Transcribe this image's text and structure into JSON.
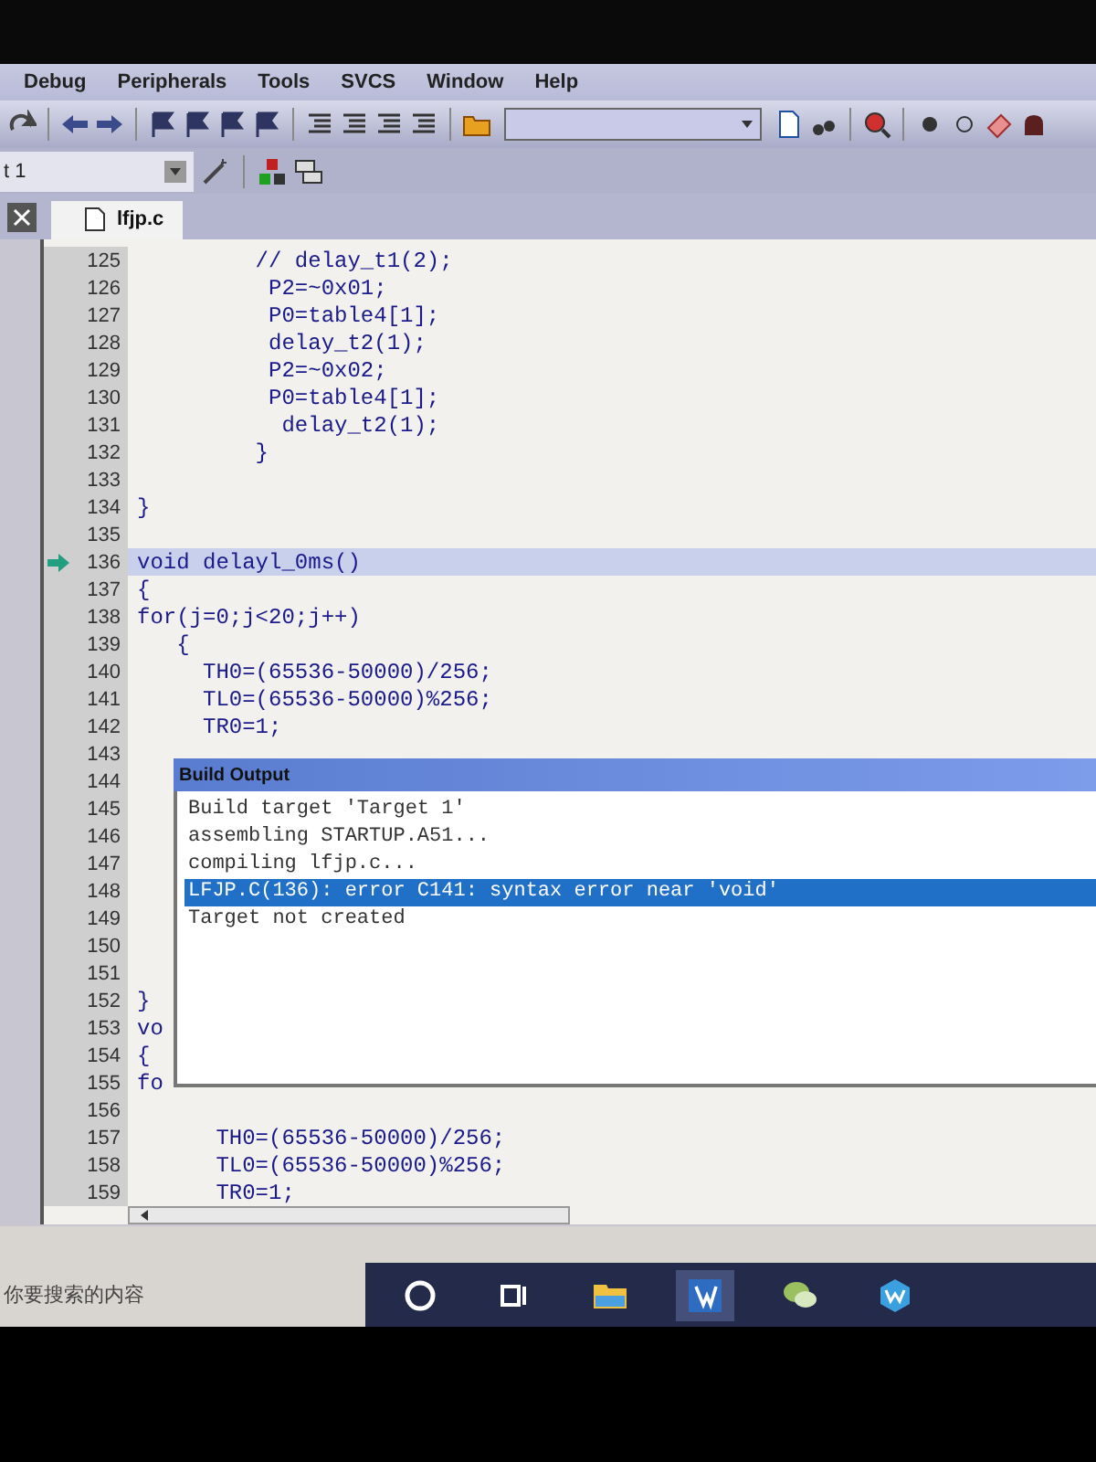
{
  "menu": [
    {
      "label": "Debug"
    },
    {
      "label": "Peripherals"
    },
    {
      "label": "Tools"
    },
    {
      "label": "SVCS"
    },
    {
      "label": "Window"
    },
    {
      "label": "Help"
    }
  ],
  "target_field": {
    "value": "t 1"
  },
  "tabs": [
    {
      "label": "lfjp.c",
      "selected": true
    }
  ],
  "code_lines": [
    {
      "number": "125",
      "text": "         // delay_t1(2);",
      "current": false
    },
    {
      "number": "126",
      "text": "          P2=~0x01;",
      "current": false
    },
    {
      "number": "127",
      "text": "          P0=table4[1];",
      "current": false
    },
    {
      "number": "128",
      "text": "          delay_t2(1);",
      "current": false
    },
    {
      "number": "129",
      "text": "          P2=~0x02;",
      "current": false
    },
    {
      "number": "130",
      "text": "          P0=table4[1];",
      "current": false
    },
    {
      "number": "131",
      "text": "           delay_t2(1);",
      "current": false
    },
    {
      "number": "132",
      "text": "         }",
      "current": false
    },
    {
      "number": "133",
      "current": false
    },
    {
      "number": "134",
      "text": "}",
      "current": false
    },
    {
      "number": "135",
      "current": false
    },
    {
      "number": "136",
      "text": "void delayl_0ms()",
      "current": true
    },
    {
      "number": "137",
      "text": "{",
      "current": false
    },
    {
      "number": "138",
      "text": "for(j=0;j<20;j++)",
      "current": false
    },
    {
      "number": "139",
      "text": "   {",
      "current": false
    },
    {
      "number": "140",
      "text": "     TH0=(65536-50000)/256;",
      "current": false
    },
    {
      "number": "141",
      "text": "     TL0=(65536-50000)%256;",
      "current": false
    },
    {
      "number": "142",
      "text": "     TR0=1;",
      "current": false
    },
    {
      "number": "143",
      "current": false
    },
    {
      "number": "144",
      "current": false
    },
    {
      "number": "145",
      "current": false
    },
    {
      "number": "146",
      "current": false
    },
    {
      "number": "147",
      "current": false
    },
    {
      "number": "148",
      "current": false
    },
    {
      "number": "149",
      "current": false
    },
    {
      "number": "150",
      "current": false
    },
    {
      "number": "151",
      "current": false
    },
    {
      "number": "152",
      "text": "}",
      "current": false
    },
    {
      "number": "153",
      "text": "vo",
      "current": false
    },
    {
      "number": "154",
      "text": "{",
      "current": false
    },
    {
      "number": "155",
      "text": "fo",
      "current": false
    },
    {
      "number": "156",
      "current": false
    },
    {
      "number": "157",
      "text": "      TH0=(65536-50000)/256;",
      "current": false
    },
    {
      "number": "158",
      "text": "      TL0=(65536-50000)%256;",
      "current": false
    },
    {
      "number": "159",
      "text": "      TR0=1;",
      "current": false
    }
  ],
  "build_output": {
    "title": "Build Output",
    "lines": [
      {
        "text": "Build target 'Target 1'",
        "selected": false
      },
      {
        "text": "assembling STARTUP.A51...",
        "selected": false
      },
      {
        "text": "compiling lfjp.c...",
        "selected": false
      },
      {
        "text": "LFJP.C(136): error C141: syntax error near 'void'",
        "selected": true
      },
      {
        "text": "Target not created",
        "selected": false
      }
    ]
  },
  "taskbar": {
    "search": {
      "placeholder": "你要搜索的内容"
    }
  }
}
